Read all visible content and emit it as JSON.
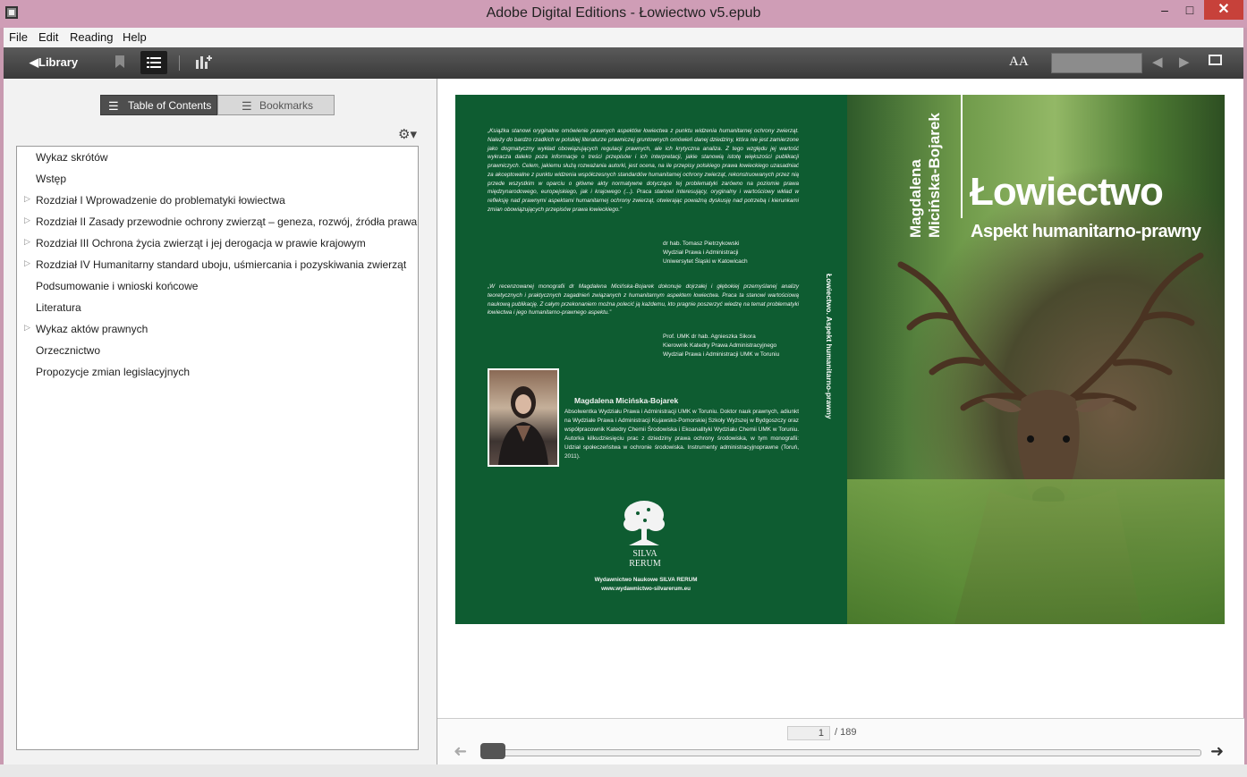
{
  "window": {
    "title": "Adobe Digital Editions - Łowiectwo v5.epub",
    "controls": {
      "minimize": "–",
      "maximize": "□",
      "close": "✕"
    }
  },
  "menu": [
    "File",
    "Edit",
    "Reading",
    "Help"
  ],
  "toolbar": {
    "library_label": "Library",
    "font_size_label": "AA",
    "search_placeholder": ""
  },
  "sidebar": {
    "tabs": [
      {
        "label": "Table of Contents",
        "active": true
      },
      {
        "label": "Bookmarks",
        "active": false
      }
    ],
    "toc": [
      {
        "label": "Wykaz skrótów",
        "expandable": false
      },
      {
        "label": "Wstęp",
        "expandable": false
      },
      {
        "label": "Rozdział I Wprowadzenie do problematyki łowiectwa",
        "expandable": true
      },
      {
        "label": "Rozdział II Zasady przewodnie ochrony zwierząt – geneza, rozwój, źródła prawa",
        "expandable": true
      },
      {
        "label": "Rozdział III Ochrona życia zwierząt i jej derogacja w prawie krajowym",
        "expandable": true
      },
      {
        "label": "Rozdział IV Humanitarny standard uboju, uśmiercania i pozyskiwania zwierząt",
        "expandable": true
      },
      {
        "label": "Podsumowanie i wnioski końcowe",
        "expandable": false
      },
      {
        "label": "Literatura",
        "expandable": false
      },
      {
        "label": "Wykaz aktów prawnych",
        "expandable": true
      },
      {
        "label": "Orzecznictwo",
        "expandable": false
      },
      {
        "label": "Propozycje zmian legislacyjnych",
        "expandable": false
      }
    ]
  },
  "cover": {
    "front": {
      "author": [
        "Magdalena",
        "Micińska-Bojarek"
      ],
      "title": "Łowiectwo",
      "subtitle": "Aspekt humanitarno-prawny"
    },
    "spine": "Łowiectwo. Aspekt humanitarno-prawny",
    "back": {
      "quote1": "„Książka stanowi oryginalne omówienie prawnych aspektów łowiectwa z punktu widzenia humanitarnej ochrony zwierząt. Należy do bardzo rzadkich w polskiej literaturze prawniczej gruntownych omówień danej dziedziny, która nie jest zamierzone jako dogmatyczny wykład obowiązujących regulacji prawnych, ale ich krytyczna analiza. Z tego względu jej wartość wykracza daleko poza informacje o treści przepisów i ich interpretacji, jakie stanowią istotę większości publikacji prawniczych. Celem, jakiemu służą rozważania autorki, jest ocena, na ile przepisy polskiego prawa łowieckiego uzasadniać za akceptowalne z punktu widzenia współczesnych standardów humanitarnej ochrony zwierząt, rekonstruowanych przez nią przede wszystkim w oparciu o główne akty normatywne dotyczące tej problematyki zarówno na poziomie prawa międzynarodowego, europejskiego, jak i krajowego (...). Praca stanowi interesujący, oryginalny i wartościowy wkład w refleksję nad prawnymi aspektami humanitarnej ochrony zwierząt, otwierając poważną dyskusję nad potrzebą i kierunkami zmian obowiązujących przepisów prawa łowieckiego.”",
      "signature1": [
        "dr hab. Tomasz Pietrzykowski",
        "Wydział Prawa i Administracji",
        "Uniwersytet Śląski w Katowicach"
      ],
      "quote2": "„W recenzowanej monografii dr Magdalena Micińska-Bojarek dokonuje dojrzałej i głębokiej przemyślanej analizy teoretycznych i praktycznych zagadnień związanych z humanitarnym aspektem łowiectwa. Praca ta stanowi wartościową naukową publikację. Z całym przekonaniem można polecić ją każdemu, kto pragnie poszerzyć wiedzę na temat problematyki łowiectwa i jego humanitarno-prawnego aspektu.”",
      "signature2": [
        "Prof. UMK dr hab. Agnieszka Sikora",
        "Kierownik Katedry Prawa Administracyjnego",
        "Wydział Prawa i Administracji UMK w Toruniu"
      ],
      "author_name": "Magdalena Micińska-Bojarek",
      "author_bio": "Absolwentka Wydziału Prawa i Administracji UMK w Toruniu. Doktor nauk prawnych, adiunkt na Wydziale Prawa i Administracji Kujawsko-Pomorskiej Szkoły Wyższej w Bydgoszczy oraz współpracownik Katedry Chemii Środowiska i Ekoanalityki Wydziału Chemii UMK w Toruniu. Autorka kilkudziesięciu prac z dziedziny prawa ochrony środowiska, w tym monografii: Udział społeczeństwa w ochronie środowiska. Instrumenty administracyjnoprawne (Toruń, 2011).",
      "logo_line1": "SILVA",
      "logo_line2": "RERUM",
      "publisher_name": "Wydawnictwo Naukowe SILVA RERUM",
      "publisher_url": "www.wydawnictwo-silvarerum.eu"
    }
  },
  "pager": {
    "current_page": "1",
    "total_pages": "/ 189",
    "progress": 0.0
  }
}
